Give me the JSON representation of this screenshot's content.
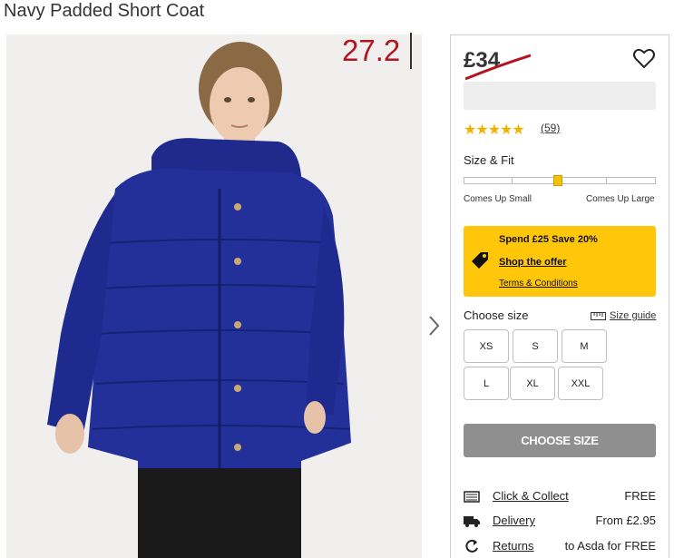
{
  "product": {
    "title": "Navy Padded Short Coat",
    "price_overlay": "27.2",
    "old_price": "£34",
    "rating": 4.5,
    "review_count": "(59)"
  },
  "size_fit": {
    "title": "Size & Fit",
    "left_label": "Comes Up Small",
    "right_label": "Comes Up Large",
    "marker_fraction": 0.49
  },
  "offer": {
    "title": "Spend £25 Save 20%",
    "link": "Shop the offer",
    "terms": "Terms & Conditions"
  },
  "sizes": {
    "title": "Choose size",
    "guide_label": "Size guide",
    "options": [
      "XS",
      "S",
      "M",
      "L",
      "XL",
      "XXL"
    ]
  },
  "cta": {
    "label": "CHOOSE SIZE"
  },
  "shipping": [
    {
      "label": "Click & Collect",
      "value": "FREE",
      "icon": "store-icon"
    },
    {
      "label": "Delivery",
      "value": "From £2.95",
      "icon": "truck-icon"
    },
    {
      "label": "Returns",
      "value": "to Asda for FREE",
      "icon": "returns-icon"
    }
  ],
  "colors": {
    "accent": "#ffc60a",
    "price_red": "#b4141e",
    "cta_disabled": "#8f8f8f",
    "star": "#f0b400"
  }
}
